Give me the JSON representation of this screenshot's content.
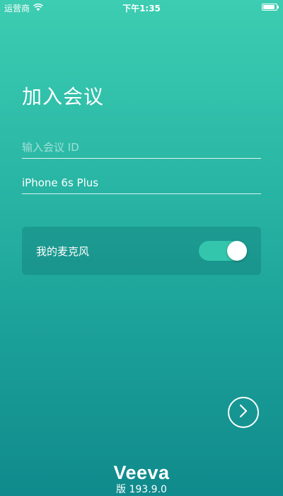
{
  "status_bar": {
    "carrier": "运营商",
    "time": "下午1:35",
    "icons": [
      "wifi-icon",
      "battery-icon"
    ]
  },
  "page": {
    "title": "加入会议"
  },
  "form": {
    "meeting_id": {
      "placeholder": "输入会议 ID",
      "value": ""
    },
    "device_name": {
      "value": "iPhone 6s Plus"
    }
  },
  "mic_setting": {
    "label": "我的麦克风",
    "enabled": true
  },
  "next_button": {
    "icon": "chevron-right-icon"
  },
  "footer": {
    "brand": "Veeva",
    "version": "版 193.9.0"
  },
  "colors": {
    "background_top": "#3ccdb2",
    "background_bottom": "#108a8c",
    "toggle_on": "#33c6ad",
    "text": "#ffffff"
  }
}
